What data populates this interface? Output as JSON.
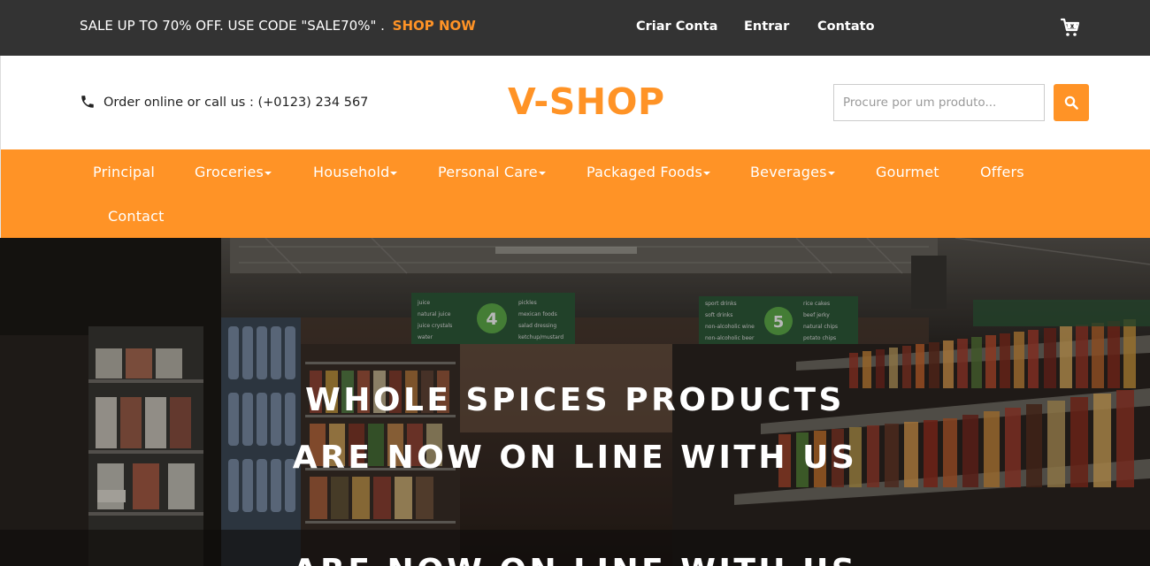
{
  "topbar": {
    "promo_text": "SALE UP TO 70% OFF. USE CODE \"SALE70%\" .",
    "shop_now": "SHOP NOW",
    "links": [
      "Criar Conta",
      "Entrar",
      "Contato"
    ],
    "cart_icon": "cart-icon"
  },
  "header": {
    "phone_icon": "phone-icon",
    "call_text": "Order online or call us : (+0123) 234 567",
    "logo": "V-SHOP",
    "search_placeholder": "Procure por um produto...",
    "search_icon": "search-icon"
  },
  "nav": {
    "items": [
      {
        "label": "Principal",
        "dropdown": false
      },
      {
        "label": "Groceries",
        "dropdown": true
      },
      {
        "label": "Household",
        "dropdown": true
      },
      {
        "label": "Personal Care",
        "dropdown": true
      },
      {
        "label": "Packaged Foods",
        "dropdown": true
      },
      {
        "label": "Beverages",
        "dropdown": true
      },
      {
        "label": "Gourmet",
        "dropdown": false
      },
      {
        "label": "Offers",
        "dropdown": false
      },
      {
        "label": "Contact",
        "dropdown": false
      }
    ]
  },
  "hero": {
    "line1": "WHOLE SPICES PRODUCTS",
    "line2": "ARE NOW ON LINE WITH US",
    "line3": "ARE NOW ON LINE WITH US",
    "signs": {
      "left": {
        "number": "4",
        "items": [
          "juice",
          "natural juice",
          "juice crystals",
          "water"
        ],
        "items2": [
          "pickles",
          "mexican foods",
          "salad dressing",
          "ketchup/mustard"
        ]
      },
      "right": {
        "number": "5",
        "items": [
          "sport drinks",
          "soft drinks",
          "non-alcoholic wine",
          "non-alcoholic beer"
        ],
        "items2": [
          "rice cakes",
          "beef jerky",
          "natural chips",
          "potato chips"
        ]
      }
    }
  },
  "colors": {
    "accent": "#ff9326",
    "topbar_bg": "#333333",
    "white": "#ffffff"
  }
}
